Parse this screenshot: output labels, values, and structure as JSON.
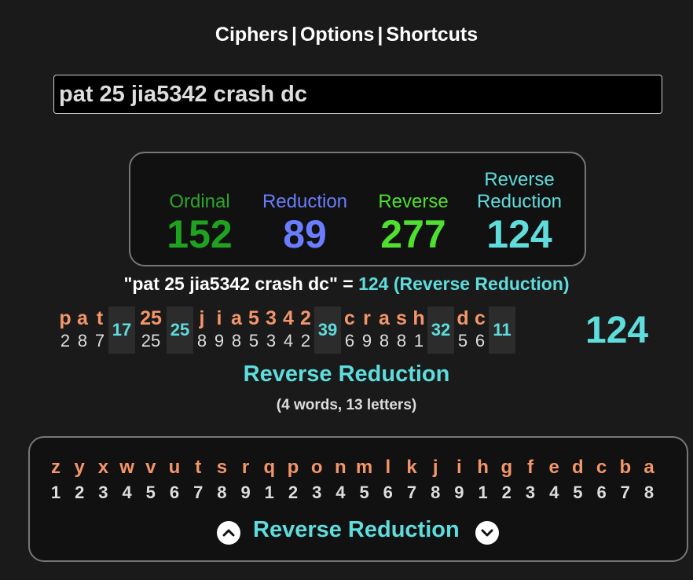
{
  "nav": {
    "ciphers": "Ciphers",
    "options": "Options",
    "shortcuts": "Shortcuts",
    "separator": "|"
  },
  "search": {
    "value": "pat 25 jia5342 crash dc"
  },
  "totals": [
    {
      "label": "Ordinal",
      "value": "152",
      "color": "#2ca52c"
    },
    {
      "label": "Reduction",
      "value": "89",
      "color": "#6a7dff"
    },
    {
      "label": "Reverse",
      "value": "277",
      "color": "#4fdf2f"
    },
    {
      "label": "Reverse Reduction",
      "value": "124",
      "color": "#5fdcdc"
    }
  ],
  "summary": {
    "phrase": "\"pat 25 jia5342 crash dc\" = ",
    "result": "124 (Reverse Reduction)"
  },
  "breakdown": {
    "cells": [
      {
        "type": "letter",
        "l": "p",
        "n": "2"
      },
      {
        "type": "letter",
        "l": "a",
        "n": "8"
      },
      {
        "type": "letter",
        "l": "t",
        "n": "7"
      },
      {
        "type": "total",
        "v": "17"
      },
      {
        "type": "letter",
        "l": "25",
        "n": "25"
      },
      {
        "type": "total",
        "v": "25"
      },
      {
        "type": "letter",
        "l": "j",
        "n": "8"
      },
      {
        "type": "letter",
        "l": "i",
        "n": "9"
      },
      {
        "type": "letter",
        "l": "a",
        "n": "8"
      },
      {
        "type": "letter",
        "l": "5",
        "n": "5"
      },
      {
        "type": "letter",
        "l": "3",
        "n": "3"
      },
      {
        "type": "letter",
        "l": "4",
        "n": "4"
      },
      {
        "type": "letter",
        "l": "2",
        "n": "2"
      },
      {
        "type": "total",
        "v": "39"
      },
      {
        "type": "letter",
        "l": "c",
        "n": "6"
      },
      {
        "type": "letter",
        "l": "r",
        "n": "9"
      },
      {
        "type": "letter",
        "l": "a",
        "n": "8"
      },
      {
        "type": "letter",
        "l": "s",
        "n": "8"
      },
      {
        "type": "letter",
        "l": "h",
        "n": "1"
      },
      {
        "type": "total",
        "v": "32"
      },
      {
        "type": "letter",
        "l": "d",
        "n": "5"
      },
      {
        "type": "letter",
        "l": "c",
        "n": "6"
      },
      {
        "type": "total",
        "v": "11"
      }
    ],
    "grand_total": "124"
  },
  "cipher_name": "Reverse Reduction",
  "counts": "(4 words, 13 letters)",
  "chart": {
    "letters": [
      "z",
      "y",
      "x",
      "w",
      "v",
      "u",
      "t",
      "s",
      "r",
      "q",
      "p",
      "o",
      "n",
      "m",
      "l",
      "k",
      "j",
      "i",
      "h",
      "g",
      "f",
      "e",
      "d",
      "c",
      "b",
      "a"
    ],
    "numbers": [
      "1",
      "2",
      "3",
      "4",
      "5",
      "6",
      "7",
      "8",
      "9",
      "1",
      "2",
      "3",
      "4",
      "5",
      "6",
      "7",
      "8",
      "9",
      "1",
      "2",
      "3",
      "4",
      "5",
      "6",
      "7",
      "8"
    ],
    "label": "Reverse Reduction",
    "prev_icon": "chevron-up-icon",
    "next_icon": "chevron-down-icon"
  }
}
